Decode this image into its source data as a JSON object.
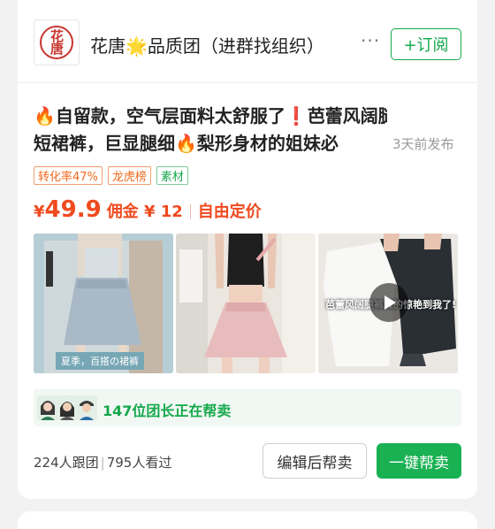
{
  "shop": {
    "logo_text": "花唐",
    "name": "花唐🌟品质团（进群找组织）",
    "more_label": "···",
    "subscribe_label": "+订阅"
  },
  "post": {
    "title_line1": "🔥自留款，空气层面料太舒服了❗芭蕾风阔腿",
    "title_line2": "短裙裤，巨显腿细🔥梨形身材的姐妹必",
    "publish_time": "3天前发布",
    "tags": [
      {
        "label": "转化率47%",
        "color": "orange"
      },
      {
        "label": "龙虎榜",
        "color": "orange"
      },
      {
        "label": "素材",
        "color": "green"
      }
    ],
    "price_symbol": "¥",
    "price": "49.9",
    "commission": "佣金 ¥ 12",
    "custom_price": "自由定价"
  },
  "images": [
    {
      "icon": "blue-skirt-shorts-photo",
      "caption": "夏季，百搭の裙裤"
    },
    {
      "icon": "pink-skirt-shorts-photo"
    },
    {
      "icon": "dark-shorts-video",
      "overlay": "芭蕾风阔腿裤真的惊艳到我了!"
    }
  ],
  "helpers": {
    "text": "147位团长正在帮卖"
  },
  "footer": {
    "followers": "224人跟团",
    "views": "795人看过",
    "separator": "|",
    "edit_button": "编辑后帮卖",
    "sell_button": "一键帮卖"
  },
  "colors": {
    "accent_green": "#19b152",
    "price_red": "#f04a1f",
    "tag_orange": "#f06a1d"
  }
}
